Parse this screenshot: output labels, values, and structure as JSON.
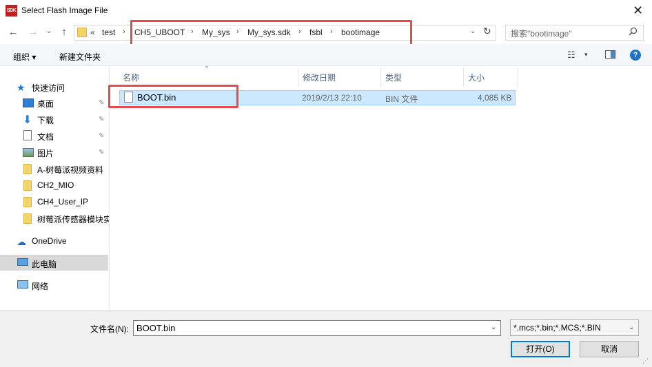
{
  "window": {
    "app_icon_text": "SDK",
    "title": "Select Flash Image File",
    "close_glyph": "✕"
  },
  "nav": {
    "back_glyph": "←",
    "forward_glyph": "→",
    "recent_glyph": "⌄",
    "up_glyph": "↑"
  },
  "address": {
    "overflow": "«",
    "crumbs": [
      "test",
      "CH5_UBOOT",
      "My_sys",
      "My_sys.sdk",
      "fsbl",
      "bootimage"
    ],
    "separator": "›",
    "dropdown_glyph": "⌄",
    "refresh_glyph": "↻"
  },
  "search": {
    "placeholder": "搜索\"bootimage\"",
    "icon": "search-icon"
  },
  "toolbar": {
    "organize": "组织 ▾",
    "new_folder": "新建文件夹",
    "view_glyph": "☷",
    "view_dropdown": "▾",
    "help": "?"
  },
  "sidebar": {
    "quick_access": "快速访问",
    "items": [
      {
        "label": "桌面",
        "icon": "desktop-icon",
        "pinned": true
      },
      {
        "label": "下载",
        "icon": "download-icon",
        "pinned": true
      },
      {
        "label": "文档",
        "icon": "document-icon",
        "pinned": true
      },
      {
        "label": "图片",
        "icon": "picture-icon",
        "pinned": true
      },
      {
        "label": "A-树莓派视频资料",
        "icon": "folder-icon",
        "pinned": false
      },
      {
        "label": "CH2_MIO",
        "icon": "folder-icon",
        "pinned": false
      },
      {
        "label": "CH4_User_IP",
        "icon": "folder-icon",
        "pinned": false
      },
      {
        "label": "树莓派传感器模块实",
        "icon": "folder-icon",
        "pinned": false
      }
    ],
    "onedrive": "OneDrive",
    "this_pc": "此电脑",
    "network": "网络",
    "pin_glyph": "📌"
  },
  "columns": {
    "name": "名称",
    "date": "修改日期",
    "type": "类型",
    "size": "大小",
    "sort_glyph": "^"
  },
  "files": [
    {
      "name": "BOOT.bin",
      "date": "2019/2/13 22:10",
      "type": "BIN 文件",
      "size": "4,085 KB"
    }
  ],
  "footer": {
    "filename_label": "文件名(N):",
    "filename_value": "BOOT.bin",
    "filter": "*.mcs;*.bin;*.MCS;*.BIN",
    "open": "打开(O)",
    "cancel": "取消",
    "dropdown_glyph": "⌄"
  },
  "colors": {
    "highlight_red": "#e8494a",
    "selection": "#cce8ff",
    "accent": "#0078d7"
  }
}
